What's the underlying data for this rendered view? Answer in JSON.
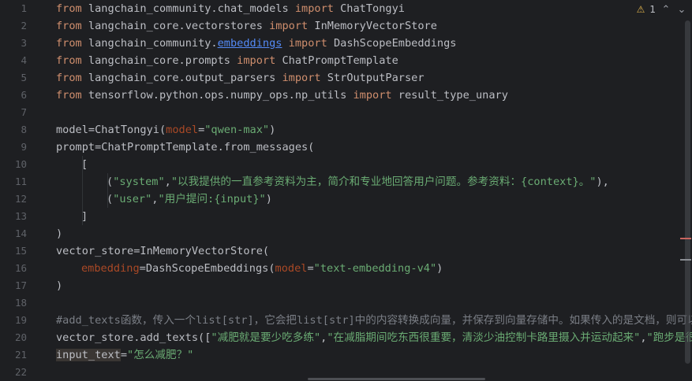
{
  "editor": {
    "line_numbers": [
      "1",
      "2",
      "3",
      "4",
      "5",
      "6",
      "7",
      "8",
      "9",
      "10",
      "11",
      "12",
      "13",
      "14",
      "15",
      "16",
      "17",
      "18",
      "19",
      "20",
      "21",
      "22"
    ],
    "inspection": {
      "warning_count": "1",
      "warning_icon": "warning-triangle-icon"
    },
    "lines": {
      "l1": {
        "t1": "from",
        "t2": " langchain_community.chat_models ",
        "t3": "import",
        "t4": " ChatTongyi"
      },
      "l2": {
        "t1": "from",
        "t2": " langchain_core.vectorstores ",
        "t3": "import",
        "t4": " InMemoryVectorStore"
      },
      "l3": {
        "t1": "from",
        "t2": " langchain_community.",
        "t2b": "embeddings",
        "t3": " import",
        "t4": " DashScopeEmbeddings"
      },
      "l4": {
        "t1": "from",
        "t2": " langchain_core.prompts ",
        "t3": "import",
        "t4": " ChatPromptTemplate"
      },
      "l5": {
        "t1": "from",
        "t2": " langchain_core.output_parsers ",
        "t3": "import",
        "t4": " StrOutputParser"
      },
      "l6": {
        "t1": "from",
        "t2": " tensorflow.python.ops.numpy_ops.np_utils ",
        "t3": "import",
        "t4": " result_type_unary"
      },
      "l8": {
        "t1": "model=ChatTongyi(",
        "t2": "model",
        "t3": "=",
        "t4": "\"qwen-max\"",
        "t5": ")"
      },
      "l9": {
        "t1": "prompt=ChatPromptTemplate.from_messages("
      },
      "l10": {
        "t1": "["
      },
      "l11": {
        "t1": "(",
        "t2": "\"system\"",
        "t3": ",",
        "t4": "\"以我提供的一直参考资料为主，简介和专业地回答用户问题。参考资料：{context}。\"",
        "t5": "),"
      },
      "l12": {
        "t1": "(",
        "t2": "\"user\"",
        "t3": ",",
        "t4": "\"用户提问:{input}\"",
        "t5": ")"
      },
      "l13": {
        "t1": "]"
      },
      "l14": {
        "t1": ")"
      },
      "l15": {
        "t1": "vector_store=InMemoryVectorStore("
      },
      "l16": {
        "t1": "embedding",
        "t2": "=DashScopeEmbeddings(",
        "t3": "model",
        "t4": "=",
        "t5": "\"text-embedding-v4\"",
        "t6": ")"
      },
      "l17": {
        "t1": ")"
      },
      "l19": {
        "t1": "#add_texts函数，传入一个list[str]，它会把list[str]中的内容转换成向量，并保存到向量存储中。如果传入的是文档，则可以使用"
      },
      "l20": {
        "t1": "vector_store.add_texts([",
        "t2": "\"减肥就是要少吃多练\"",
        "t3": ",",
        "t4": "\"在减脂期间吃东西很重要，清淡少油控制卡路里摄入并运动起来\"",
        "t5": ",",
        "t6": "\"跑步是很好的"
      },
      "l21": {
        "t1": "input_text",
        "t2": "=",
        "t3": "\"怎么减肥？\""
      }
    }
  },
  "colors": {
    "background": "#1e1f22",
    "keyword": "#cf8e6d",
    "string": "#6aab73",
    "param": "#aa4926",
    "comment": "#7a7e85",
    "text": "#bcbec4",
    "link": "#548af7",
    "warning": "#e0b34c"
  }
}
